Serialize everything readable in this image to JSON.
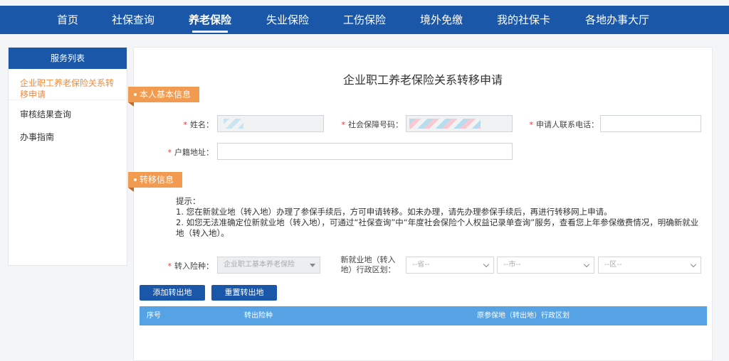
{
  "nav": {
    "items": [
      {
        "label": "首页"
      },
      {
        "label": "社保查询"
      },
      {
        "label": "养老保险"
      },
      {
        "label": "失业保险"
      },
      {
        "label": "工伤保险"
      },
      {
        "label": "境外免缴"
      },
      {
        "label": "我的社保卡"
      },
      {
        "label": "各地办事大厅"
      }
    ],
    "active": "养老保险"
  },
  "sidebar": {
    "title": "服务列表",
    "items": [
      {
        "label": "企业职工养老保险关系转移申请"
      },
      {
        "label": "审核结果查询"
      },
      {
        "label": "办事指南"
      }
    ]
  },
  "page": {
    "title": "企业职工养老保险关系转移申请"
  },
  "sections": {
    "basic": "本人基本信息",
    "transfer": "转移信息"
  },
  "form": {
    "required_mark": "*",
    "name_label": "姓名：",
    "ssn_label": "社会保障号码：",
    "phone_label": "申请人联系电话：",
    "address_label": "户籍地址：",
    "insurance_label": "转入险种：",
    "insurance_value": "企业职工基本养老保险",
    "region_label_line1": "新就业地（转入",
    "region_label_line2": "地）行政区划：",
    "province_placeholder": "--省--",
    "city_placeholder": "--市--",
    "district_placeholder": "--区--"
  },
  "tips": {
    "title": "提示：",
    "line1": "1. 您在新就业地（转入地）办理了参保手续后，方可申请转移。如未办理，请先办理参保手续后，再进行转移网上申请。",
    "line2": "2. 如您无法准确定位新就业地（转入地），可通过“社保查询”中“年度社会保险个人权益记录单查询”服务，查看您上年参保缴费情况，明确新就业地（转入地）。"
  },
  "buttons": {
    "add": "添加转出地",
    "reset": "重置转出地"
  },
  "table": {
    "columns": [
      "序号",
      "转出险种",
      "原参保地（转出地）行政区划"
    ]
  },
  "colors": {
    "nav_bg": "#1b57a8",
    "section_tag": "#f29a4f",
    "active_link": "#f08a3c",
    "table_head": "#55a2e5",
    "required": "#e13b3b"
  }
}
